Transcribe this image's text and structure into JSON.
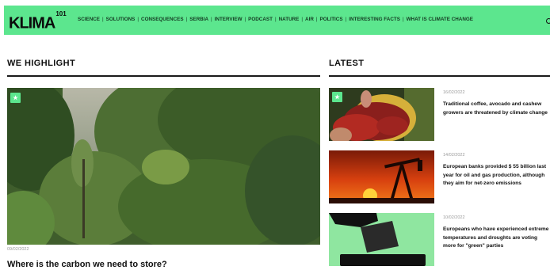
{
  "header": {
    "logo": "KLIMA",
    "logo_suffix": "101",
    "menu": [
      "SCIENCE",
      "SOLUTIONS",
      "CONSEQUENCES",
      "SERBIA",
      "INTERVIEW",
      "PODCAST",
      "NATURE",
      "AIR",
      "POLITICS",
      "INTERESTING FACTS",
      "WHAT IS CLIMATE CHANGE"
    ],
    "separator": "|",
    "search_icon": "search-icon"
  },
  "highlight": {
    "section_title": "WE HIGHLIGHT",
    "date": "09/02/2022",
    "title": "Where is the carbon we need to store?"
  },
  "latest": {
    "section_title": "LATEST",
    "items": [
      {
        "date": "16/02/2022",
        "title": "Traditional coffee, avocado and cashew growers are threatened by climate change"
      },
      {
        "date": "14/02/2022",
        "title": "European banks provided $ 55 billion last year for oil and gas production, although they aim for net-zero emissions"
      },
      {
        "date": "10/02/2022",
        "title": "Europeans who have experienced extreme temperatures and droughts are voting more for \"green\" parties"
      }
    ]
  },
  "colors": {
    "brand_green": "#5ce68e",
    "text": "#111111",
    "muted": "#9a9a9a"
  }
}
